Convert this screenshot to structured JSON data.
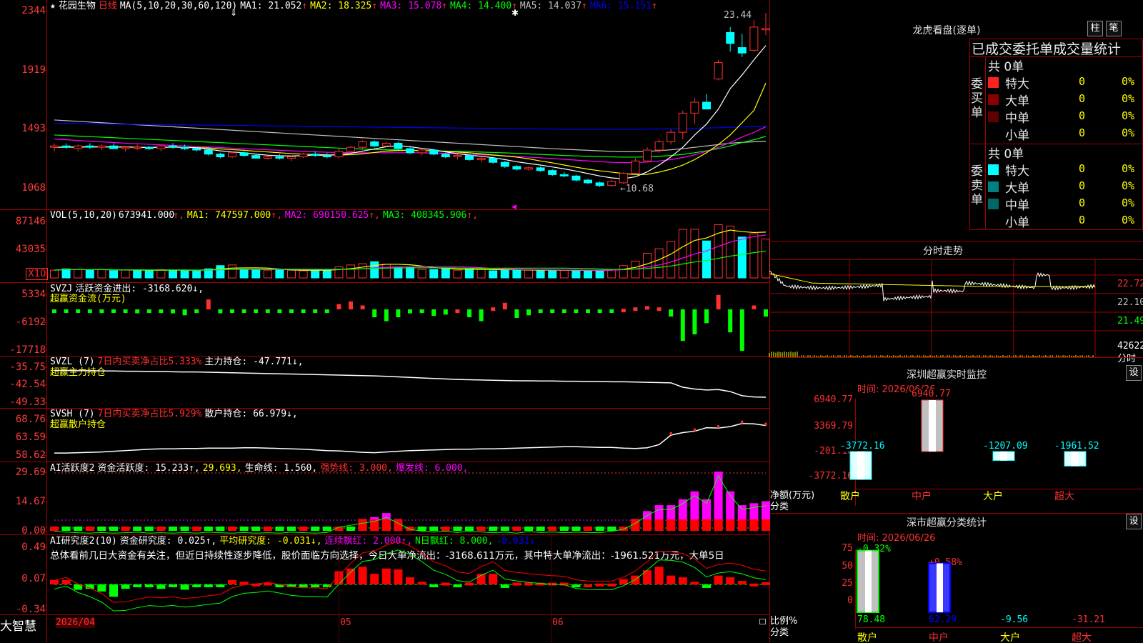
{
  "stock": {
    "name": "花园生物",
    "period": "日线"
  },
  "colors": {
    "up": "#ff3030",
    "down": "#00ffff",
    "ma1": "#ffffff",
    "ma2": "#ffff00",
    "ma3": "#ff00ff",
    "ma4": "#00ff00",
    "ma5": "#c0c0c0",
    "ma6": "#0000ff",
    "grid": "#a00000"
  },
  "main": {
    "ma_label": "MA(5,10,20,30,60,120)",
    "ma": [
      {
        "label": "MA1: 21.052",
        "color": "#ffffff"
      },
      {
        "label": "MA2: 18.325",
        "color": "#ffff00"
      },
      {
        "label": "MA3: 15.078",
        "color": "#ff00ff"
      },
      {
        "label": "MA4: 14.400",
        "color": "#00ff00"
      },
      {
        "label": "MA5: 14.037",
        "color": "#c0c0c0"
      },
      {
        "label": "MA6: 15.151",
        "color": "#0000ff"
      }
    ],
    "y_ticks": [
      "2344",
      "1919",
      "1493",
      "1068"
    ],
    "high_label": "23.44",
    "low_label": "←10.68",
    "candles": [
      [
        13.6,
        13.9,
        13.3,
        13.7
      ],
      [
        13.7,
        13.9,
        13.5,
        13.6
      ],
      [
        13.5,
        13.8,
        13.3,
        13.7
      ],
      [
        13.7,
        13.9,
        13.5,
        13.6
      ],
      [
        13.6,
        13.8,
        13.4,
        13.7
      ],
      [
        13.7,
        13.9,
        13.5,
        13.5
      ],
      [
        13.5,
        13.7,
        13.3,
        13.6
      ],
      [
        13.6,
        13.8,
        13.4,
        13.6
      ],
      [
        13.6,
        13.7,
        13.4,
        13.5
      ],
      [
        13.5,
        13.8,
        13.3,
        13.7
      ],
      [
        13.7,
        13.9,
        13.5,
        13.6
      ],
      [
        13.6,
        13.8,
        13.4,
        13.5
      ],
      [
        13.5,
        13.6,
        13.3,
        13.4
      ],
      [
        13.4,
        13.6,
        13.0,
        13.1
      ],
      [
        13.1,
        13.2,
        12.8,
        12.9
      ],
      [
        12.9,
        13.3,
        12.8,
        13.2
      ],
      [
        13.2,
        13.3,
        12.9,
        13.0
      ],
      [
        13.0,
        13.1,
        12.8,
        12.8
      ],
      [
        12.8,
        13.0,
        12.7,
        12.9
      ],
      [
        12.9,
        13.1,
        12.7,
        12.8
      ],
      [
        12.8,
        13.0,
        12.6,
        12.9
      ],
      [
        12.9,
        13.2,
        12.8,
        13.1
      ],
      [
        13.1,
        13.3,
        12.9,
        13.0
      ],
      [
        13.0,
        13.2,
        12.8,
        12.9
      ],
      [
        12.9,
        13.5,
        12.8,
        13.3
      ],
      [
        13.3,
        13.7,
        13.2,
        13.6
      ],
      [
        13.6,
        14.1,
        13.5,
        14.0
      ],
      [
        14.0,
        14.1,
        13.6,
        13.7
      ],
      [
        13.7,
        14.0,
        13.6,
        13.9
      ],
      [
        13.9,
        14.0,
        13.4,
        13.5
      ],
      [
        13.5,
        13.6,
        13.1,
        13.2
      ],
      [
        13.2,
        13.5,
        13.0,
        13.4
      ],
      [
        13.4,
        13.5,
        13.0,
        13.1
      ],
      [
        13.1,
        13.2,
        12.8,
        12.9
      ],
      [
        12.9,
        13.1,
        12.7,
        13.0
      ],
      [
        13.0,
        13.1,
        12.6,
        12.7
      ],
      [
        12.7,
        12.9,
        12.5,
        12.8
      ],
      [
        12.8,
        12.9,
        12.4,
        12.5
      ],
      [
        12.5,
        12.6,
        12.1,
        12.2
      ],
      [
        12.2,
        12.3,
        11.9,
        12.0
      ],
      [
        12.0,
        12.2,
        11.9,
        12.1
      ],
      [
        12.1,
        12.2,
        11.8,
        11.9
      ],
      [
        11.9,
        12.0,
        11.5,
        11.6
      ],
      [
        11.6,
        11.8,
        11.4,
        11.5
      ],
      [
        11.5,
        11.6,
        11.1,
        11.2
      ],
      [
        11.2,
        11.3,
        10.9,
        11.0
      ],
      [
        11.0,
        11.1,
        10.68,
        10.8
      ],
      [
        10.8,
        11.2,
        10.7,
        11.1
      ],
      [
        11.0,
        11.8,
        10.9,
        11.7
      ],
      [
        11.7,
        12.8,
        11.6,
        12.6
      ],
      [
        12.6,
        13.6,
        12.5,
        13.4
      ],
      [
        13.4,
        14.2,
        13.2,
        14.0
      ],
      [
        14.0,
        14.9,
        13.8,
        14.7
      ],
      [
        14.7,
        16.3,
        14.2,
        16.1
      ],
      [
        16.1,
        17.2,
        15.3,
        16.9
      ],
      [
        16.9,
        17.5,
        16.4,
        16.4
      ],
      [
        18.6,
        20.0,
        18.5,
        19.8
      ],
      [
        22.0,
        22.4,
        20.6,
        21.2
      ],
      [
        20.9,
        21.9,
        20.2,
        20.5
      ],
      [
        20.7,
        22.9,
        20.6,
        22.4
      ],
      [
        22.2,
        23.44,
        21.8,
        22.3
      ]
    ],
    "ma_series": {
      "ma1": [
        13.6,
        13.62,
        13.62,
        13.64,
        13.64,
        13.62,
        13.62,
        13.6,
        13.58,
        13.6,
        13.62,
        13.6,
        13.56,
        13.46,
        13.34,
        13.26,
        13.2,
        13.1,
        13.02,
        12.98,
        12.96,
        13.0,
        13.02,
        13.02,
        13.06,
        13.16,
        13.32,
        13.48,
        13.64,
        13.72,
        13.64,
        13.52,
        13.42,
        13.26,
        13.14,
        13.02,
        12.94,
        12.84,
        12.7,
        12.54,
        12.42,
        12.3,
        12.16,
        12.02,
        11.86,
        11.68,
        11.5,
        11.36,
        11.3,
        11.44,
        11.8,
        12.3,
        12.9,
        13.6,
        14.5,
        15.3,
        16.4,
        17.9,
        18.9,
        20.0,
        21.05
      ],
      "ma2": [
        13.6,
        13.6,
        13.61,
        13.62,
        13.62,
        13.62,
        13.62,
        13.61,
        13.6,
        13.6,
        13.6,
        13.6,
        13.58,
        13.55,
        13.48,
        13.43,
        13.38,
        13.31,
        13.26,
        13.2,
        13.14,
        13.1,
        13.08,
        13.05,
        13.04,
        13.06,
        13.12,
        13.22,
        13.32,
        13.36,
        13.38,
        13.36,
        13.34,
        13.3,
        13.25,
        13.2,
        13.12,
        13.04,
        12.96,
        12.88,
        12.76,
        12.6,
        12.46,
        12.3,
        12.14,
        12.0,
        11.88,
        11.78,
        11.68,
        11.6,
        11.62,
        11.78,
        12.0,
        12.3,
        12.7,
        13.2,
        13.8,
        14.5,
        15.4,
        16.3,
        18.3
      ],
      "ma3": [
        14.2,
        14.15,
        14.1,
        14.05,
        14.0,
        13.95,
        13.9,
        13.86,
        13.82,
        13.78,
        13.74,
        13.7,
        13.66,
        13.62,
        13.58,
        13.54,
        13.5,
        13.46,
        13.42,
        13.38,
        13.34,
        13.3,
        13.27,
        13.24,
        13.22,
        13.21,
        13.2,
        13.2,
        13.2,
        13.2,
        13.2,
        13.19,
        13.18,
        13.16,
        13.13,
        13.1,
        13.06,
        13.02,
        12.98,
        12.93,
        12.88,
        12.83,
        12.78,
        12.72,
        12.66,
        12.6,
        12.55,
        12.5,
        12.48,
        12.48,
        12.52,
        12.6,
        12.7,
        12.85,
        13.05,
        13.3,
        13.6,
        13.95,
        14.35,
        14.7,
        15.1
      ],
      "ma4": [
        14.5,
        14.46,
        14.42,
        14.38,
        14.34,
        14.3,
        14.26,
        14.22,
        14.18,
        14.14,
        14.1,
        14.06,
        14.02,
        13.98,
        13.94,
        13.9,
        13.86,
        13.82,
        13.78,
        13.74,
        13.7,
        13.66,
        13.62,
        13.58,
        13.54,
        13.5,
        13.47,
        13.44,
        13.42,
        13.4,
        13.38,
        13.36,
        13.34,
        13.32,
        13.3,
        13.28,
        13.25,
        13.22,
        13.19,
        13.16,
        13.12,
        13.08,
        13.04,
        13.0,
        12.97,
        12.94,
        12.92,
        12.9,
        12.88,
        12.88,
        12.9,
        12.94,
        13.0,
        13.08,
        13.2,
        13.34,
        13.5,
        13.7,
        13.95,
        14.15,
        14.4
      ],
      "ma5": [
        15.6,
        15.55,
        15.5,
        15.45,
        15.4,
        15.35,
        15.3,
        15.25,
        15.2,
        15.15,
        15.1,
        15.05,
        15.0,
        14.95,
        14.9,
        14.85,
        14.8,
        14.75,
        14.7,
        14.65,
        14.6,
        14.55,
        14.5,
        14.45,
        14.4,
        14.35,
        14.3,
        14.25,
        14.2,
        14.15,
        14.1,
        14.05,
        14.0,
        13.95,
        13.9,
        13.85,
        13.8,
        13.75,
        13.7,
        13.65,
        13.6,
        13.55,
        13.5,
        13.46,
        13.42,
        13.38,
        13.34,
        13.3,
        13.28,
        13.28,
        13.3,
        13.35,
        13.42,
        13.5,
        13.6,
        13.7,
        13.8,
        13.9,
        13.96,
        14.0,
        14.04
      ],
      "ma6": [
        15.35,
        15.34,
        15.33,
        15.32,
        15.31,
        15.3,
        15.29,
        15.28,
        15.27,
        15.26,
        15.25,
        15.24,
        15.23,
        15.22,
        15.21,
        15.2,
        15.19,
        15.18,
        15.17,
        15.16,
        15.15,
        15.14,
        15.13,
        15.12,
        15.11,
        15.1,
        15.09,
        15.08,
        15.07,
        15.06,
        15.05,
        15.04,
        15.03,
        15.02,
        15.01,
        15.0,
        14.99,
        14.98,
        14.97,
        14.96,
        14.95,
        14.94,
        14.93,
        14.92,
        14.92,
        14.92,
        14.92,
        14.92,
        14.92,
        14.92,
        14.93,
        14.94,
        14.95,
        14.97,
        14.99,
        15.01,
        15.03,
        15.06,
        15.09,
        15.12,
        15.15
      ]
    }
  },
  "vol": {
    "label": "VOL(5,10,20)",
    "value": "673941.000",
    "ma": [
      {
        "label": "MA1: 747597.000",
        "color": "#ffff00"
      },
      {
        "label": "MA2: 690150.625",
        "color": "#ff00ff"
      },
      {
        "label": "MA3: 408345.906",
        "color": "#00ff00"
      }
    ],
    "y_ticks": [
      "87146",
      "43035"
    ],
    "unit": "X10",
    "bars": [
      12,
      14,
      13,
      12,
      13,
      11,
      12,
      12,
      11,
      13,
      12,
      12,
      11,
      14,
      19,
      20,
      13,
      12,
      12,
      12,
      12,
      11,
      12,
      12,
      17,
      20,
      22,
      25,
      21,
      17,
      16,
      13,
      13,
      14,
      12,
      14,
      13,
      11,
      13,
      12,
      12,
      12,
      11,
      12,
      12,
      11,
      12,
      13,
      19,
      26,
      38,
      45,
      56,
      75,
      75,
      57,
      82,
      80,
      63,
      68,
      60
    ],
    "up": [
      1,
      0,
      1,
      0,
      1,
      0,
      1,
      0,
      0,
      1,
      0,
      0,
      0,
      0,
      0,
      1,
      0,
      0,
      1,
      0,
      1,
      1,
      0,
      0,
      1,
      1,
      1,
      0,
      1,
      0,
      0,
      1,
      0,
      0,
      1,
      0,
      1,
      0,
      0,
      0,
      1,
      0,
      0,
      1,
      0,
      0,
      0,
      1,
      1,
      1,
      1,
      1,
      1,
      1,
      1,
      0,
      1,
      1,
      0,
      1,
      1
    ]
  },
  "svzj": {
    "label": "SVZJ",
    "desc": "活跃资金进出: -3168.620↓,",
    "sub": "超赢资金流(万元)",
    "y_ticks": [
      "5334",
      "-6192",
      "-17718"
    ],
    "values": [
      -200,
      -500,
      -300,
      -400,
      -500,
      -300,
      -500,
      -600,
      -500,
      -400,
      -600,
      -900,
      -300,
      1500,
      -600,
      -500,
      -300,
      -200,
      -300,
      -100,
      -300,
      -200,
      -500,
      -300,
      800,
      1200,
      600,
      -1200,
      -1800,
      -1200,
      -600,
      -200,
      -1000,
      -800,
      0,
      -1200,
      -1800,
      300,
      1000,
      -1300,
      -900,
      -300,
      -500,
      -300,
      -400,
      -200,
      -200,
      -300,
      100,
      300,
      500,
      300,
      -1100,
      -4800,
      -3800,
      -2100,
      2200,
      -3500,
      -6300,
      600,
      -1100
    ]
  },
  "svzl": {
    "label": "SVZL  (7)",
    "desc7": "7日内买卖净占比5.333%",
    "desc": "主力持仓: -47.771↓,",
    "sub": "超赢主力持仓",
    "y_ticks": [
      "-35.75",
      "-42.54",
      "-49.33"
    ],
    "values": [
      -37.0,
      -37.0,
      -37.1,
      -37.1,
      -37.2,
      -37.2,
      -37.3,
      -37.3,
      -37.4,
      -37.4,
      -37.5,
      -37.6,
      -37.6,
      -37.7,
      -37.8,
      -37.9,
      -38.0,
      -38.1,
      -38.2,
      -38.3,
      -38.4,
      -38.5,
      -38.6,
      -38.7,
      -38.8,
      -38.9,
      -39.0,
      -39.1,
      -39.3,
      -39.5,
      -39.7,
      -39.9,
      -40.1,
      -40.3,
      -40.5,
      -40.6,
      -40.7,
      -40.8,
      -40.9,
      -41.0,
      -41.0,
      -41.1,
      -41.1,
      -41.2,
      -41.2,
      -41.3,
      -41.3,
      -41.4,
      -41.4,
      -41.5,
      -41.6,
      -41.7,
      -41.8,
      -43.5,
      -44.2,
      -44.6,
      -44.4,
      -45.2,
      -46.8,
      -47.3,
      -47.4
    ]
  },
  "svsh": {
    "label": "SVSH  (7)",
    "desc7": "7日内买卖净占比5.929%",
    "desc": "散户持仓: 66.979↓,",
    "sub": "超赢散户持仓",
    "y_ticks": [
      "68.76",
      "63.59",
      "58.62"
    ],
    "values": [
      59.2,
      59.2,
      59.3,
      59.4,
      59.5,
      59.7,
      59.9,
      60.1,
      60.3,
      60.4,
      60.4,
      60.5,
      60.5,
      60.6,
      60.6,
      60.6,
      60.7,
      60.7,
      60.6,
      60.5,
      60.4,
      60.3,
      60.1,
      59.9,
      59.8,
      59.6,
      59.4,
      59.3,
      59.5,
      59.7,
      59.9,
      60.0,
      60.1,
      60.2,
      60.3,
      60.3,
      60.4,
      60.4,
      60.5,
      60.6,
      60.7,
      60.8,
      60.9,
      61.0,
      61.0,
      60.9,
      60.8,
      60.8,
      60.6,
      60.5,
      60.7,
      61.6,
      64.3,
      65.0,
      65.4,
      66.4,
      66.3,
      66.7,
      67.6,
      67.5,
      67.0
    ]
  },
  "ai1": {
    "label": "AI活跃度2",
    "desc": "资金活跃度: 15.233↑,",
    "v2": "29.693,",
    "life": "生命线: 1.560,",
    "strong": "强势线: 3.000,",
    "burst": "爆发线: 6.000,",
    "y_ticks": [
      "29.69",
      "14.67",
      "0.00"
    ],
    "values": [
      2,
      1.5,
      1.2,
      1,
      1.3,
      1,
      1.2,
      1.5,
      1,
      1.2,
      1,
      1.3,
      1,
      1.5,
      1.2,
      1,
      1.3,
      1,
      1.2,
      1,
      1.5,
      1.2,
      1,
      1.3,
      4,
      5,
      6,
      7,
      9,
      6,
      3,
      2,
      1.5,
      2,
      1.3,
      2,
      1.6,
      1.2,
      1.5,
      1,
      1.8,
      1.3,
      1.6,
      1.2,
      1.5,
      1.3,
      1.2,
      2,
      3,
      6,
      10,
      13,
      13,
      16,
      20,
      16,
      30,
      20,
      13,
      14,
      15
    ]
  },
  "ai2": {
    "label": "AI研究度2(10)",
    "desc": "资金研究度: 0.025↑,",
    "avg": "平均研究度: -0.031↓,",
    "red": "连续飘红: 2.000↑,",
    "nred": "N日飘红: 8.000,",
    "last": "-0.031↓",
    "y_ticks": [
      "0.49",
      "0.07",
      "-0.34"
    ],
    "summary": "总体看前几日大资金有关注，但近日持续性逐步降低，股价面临方向选择，今日大单净流出：-3168.611万元，其中特大单净流出：-1961.521万元，大单5日",
    "values": [
      0.05,
      0.05,
      -0.06,
      -0.05,
      -0.08,
      -0.14,
      -0.05,
      -0.02,
      -0.02,
      -0.05,
      -0.03,
      -0.06,
      -0.03,
      -0.02,
      -0.02,
      0.05,
      0.03,
      0.01,
      0.02,
      -0.02,
      -0.03,
      -0.02,
      -0.01,
      -0.02,
      0.15,
      0.18,
      0.2,
      0.12,
      0.18,
      0.17,
      0.08,
      0.03,
      -0.01,
      0.02,
      -0.02,
      0.02,
      0.12,
      0.12,
      -0.04,
      0.02,
      0.02,
      0.02,
      0.02,
      0.02,
      -0.02,
      0.0,
      0.01,
      0.01,
      0.06,
      0.1,
      0.16,
      0.2,
      0.1,
      0.08,
      0.03,
      -0.04,
      0.1,
      0.08,
      0.04,
      0.01,
      0.025
    ]
  },
  "dates": [
    "2026/04",
    "05",
    "06"
  ],
  "bottom": {
    "brand": "大智慧"
  },
  "lhb": {
    "title": "龙虎看盘(逐单)",
    "btn1": "柱",
    "btn2": "笔",
    "tabs": "已成交委托单成交量统计",
    "buy": {
      "side": "委买单",
      "total": "共 0单",
      "rows": [
        {
          "label": "特大",
          "v": "0",
          "p": "0%",
          "color": "#ff2020"
        },
        {
          "label": "大单",
          "v": "0",
          "p": "0%",
          "color": "#8a0000"
        },
        {
          "label": "中单",
          "v": "0",
          "p": "0%",
          "color": "#600000"
        },
        {
          "label": "小单",
          "v": "0",
          "p": "0%",
          "color": "#000000"
        }
      ]
    },
    "sell": {
      "side": "委卖单",
      "total": "共 0单",
      "rows": [
        {
          "label": "特大",
          "v": "0",
          "p": "0%",
          "color": "#00ffff"
        },
        {
          "label": "大单",
          "v": "0",
          "p": "0%",
          "color": "#008080"
        },
        {
          "label": "中单",
          "v": "0",
          "p": "0%",
          "color": "#006868"
        },
        {
          "label": "小单",
          "v": "0",
          "p": "0%",
          "color": "#000000"
        }
      ]
    }
  },
  "fenshi": {
    "title": "分时走势",
    "y_ticks": [
      "22.72",
      "22.10",
      "21.49"
    ],
    "vol_tick": "42622",
    "unit": "分时"
  },
  "sz": {
    "title": "深圳超赢实时监控",
    "btn": "设",
    "time": "时间: 2026/06/26",
    "y_ticks": [
      "6940.77",
      "3369.79",
      "-201.18",
      "-3772.16"
    ],
    "ylab1": "净额(万元)",
    "ylab2": "分类",
    "cats": [
      "散户",
      "中户",
      "大户",
      "超大"
    ],
    "values": [
      -3772.16,
      6940.77,
      -1207.09,
      -1961.52
    ],
    "value_labels": [
      "-3772.16",
      "6940.77",
      "-1207.09",
      "-1961.52"
    ]
  },
  "sc": {
    "title": "深市超赢分类统计",
    "btn": "设",
    "time": "时间: 2026/06/26",
    "y_ticks": [
      "75",
      "50",
      "25",
      "0"
    ],
    "ylab1": "比例%",
    "ylab2": "分类",
    "cats": [
      "散户",
      "中户",
      "大户",
      "超大"
    ],
    "top": [
      "-0.32%",
      "+0.58%"
    ],
    "values": [
      78.48,
      62.29,
      -9.56,
      -31.21
    ],
    "value_labels": [
      "78.48",
      "62.29",
      "-9.56",
      "-31.21"
    ]
  }
}
